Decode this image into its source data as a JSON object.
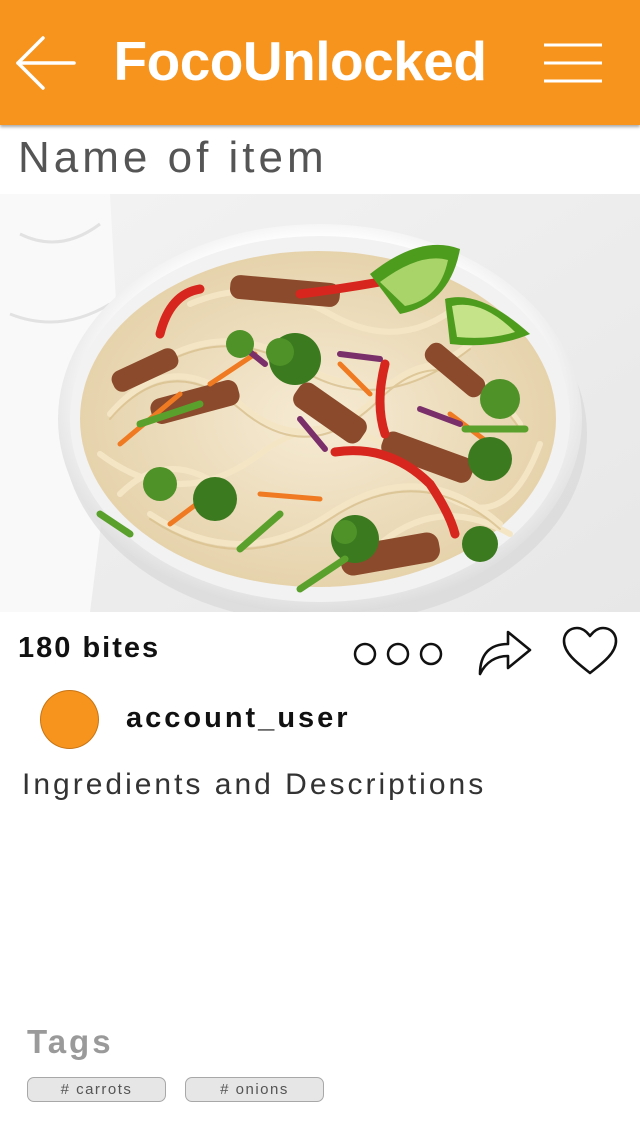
{
  "header": {
    "title": "FocoUnlocked",
    "back_icon": "arrow-left-icon",
    "menu_icon": "hamburger-menu-icon",
    "background_color": "#f7941d"
  },
  "item": {
    "name": "Name of item",
    "bites": "180 bites",
    "description": "Ingredients and Descriptions"
  },
  "actions": {
    "more_icon": "more-dots-icon",
    "share_icon": "share-arrow-icon",
    "like_icon": "heart-icon"
  },
  "user": {
    "username": "account_user",
    "avatar_color": "#f7941d"
  },
  "tags": {
    "label": "Tags",
    "items": [
      "# carrots",
      "# onions"
    ]
  }
}
